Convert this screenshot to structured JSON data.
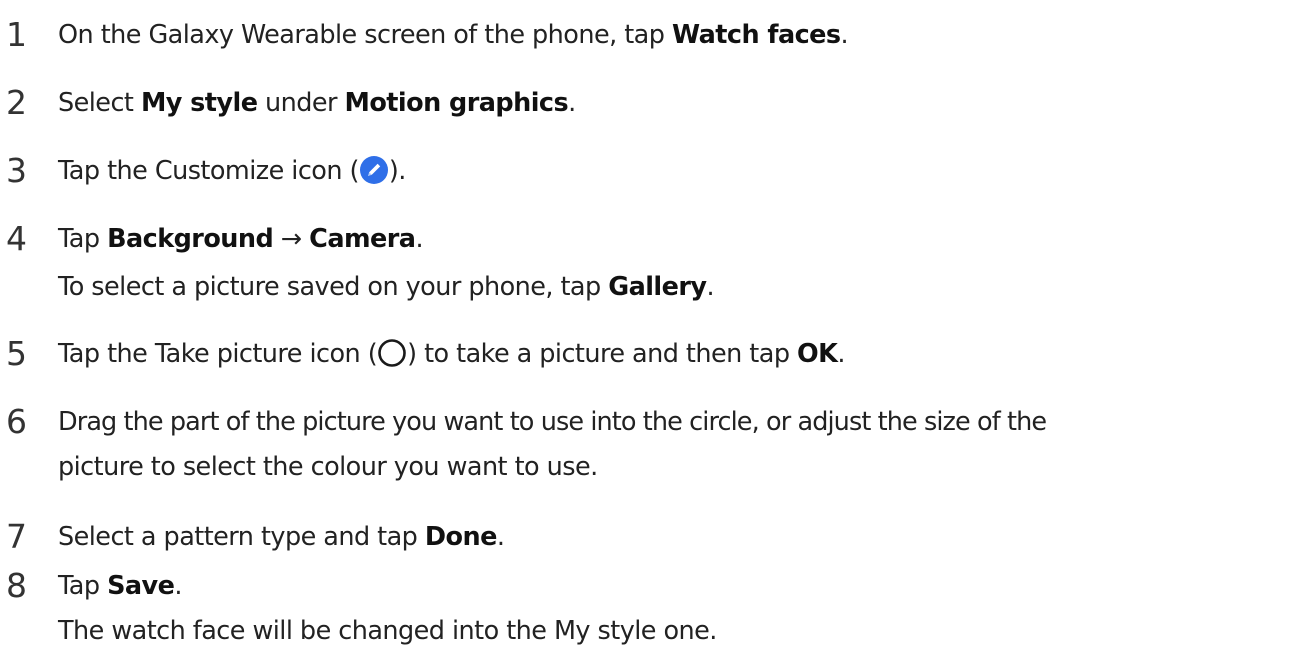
{
  "steps": [
    {
      "number": "1",
      "text_a": "On the Galaxy Wearable screen of the phone, tap ",
      "bold_a": "Watch faces",
      "text_b": "."
    },
    {
      "number": "2",
      "text_a": "Select ",
      "bold_a": "My style",
      "text_b": " under ",
      "bold_b": "Motion graphics",
      "text_c": "."
    },
    {
      "number": "3",
      "text_a": "Tap the Customize icon (",
      "icon": "pencil-edit-icon",
      "text_b": ")."
    },
    {
      "number": "4",
      "text_a": "Tap ",
      "bold_a": "Background",
      "text_b": " → ",
      "bold_b": "Camera",
      "text_c": ".",
      "note_a": "To select a picture saved on your phone, tap ",
      "note_bold": "Gallery",
      "note_b": "."
    },
    {
      "number": "5",
      "text_a": "Tap the Take picture icon (",
      "icon": "capture-circle-icon",
      "text_b": ") to take a picture and then tap ",
      "bold_a": "OK",
      "text_c": "."
    },
    {
      "number": "6",
      "line_1": "Drag the part of the picture you want to use into the circle, or adjust the size of the",
      "line_2": "picture to select the colour you want to use."
    },
    {
      "number": "7",
      "text_a": "Select a pattern type and tap ",
      "bold_a": "Done",
      "text_b": "."
    },
    {
      "number": "8",
      "text_a": "Tap ",
      "bold_a": "Save",
      "text_b": ".",
      "note": "The watch face will be changed into the My style one."
    }
  ],
  "colors": {
    "text": "#222222",
    "accent_icon": "#2f6fe8"
  }
}
